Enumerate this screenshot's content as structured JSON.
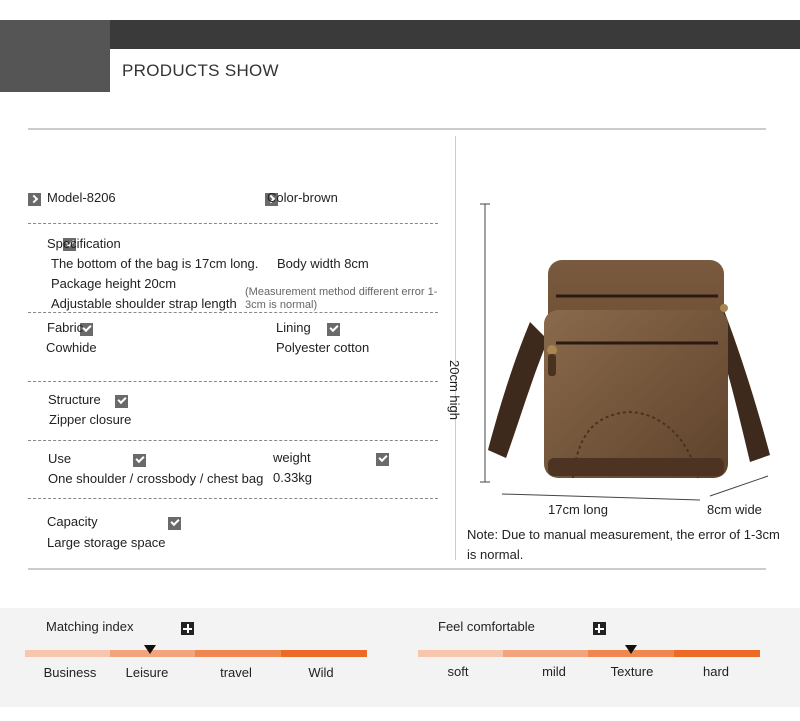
{
  "header": {
    "title": "PRODUCTS SHOW"
  },
  "specs": {
    "model": "Model-8206",
    "color": "Color-brown",
    "specification_title": "Specification",
    "spec_line1": "The bottom of the bag is 17cm long.",
    "spec_line1b": "Body width 8cm",
    "spec_line2": "Package height 20cm",
    "spec_line3": "Adjustable shoulder strap length",
    "spec_note": "(Measurement method different error 1-3cm is normal)",
    "fabric_title": "Fabric",
    "fabric_value": "Cowhide",
    "lining_title": "Lining",
    "lining_value": "Polyester cotton",
    "structure_title": "Structure",
    "structure_value": "Zipper closure",
    "use_title": "Use",
    "use_value": "One shoulder / crossbody / chest bag",
    "weight_title": "weight",
    "weight_value": "0.33kg",
    "capacity_title": "Capacity",
    "capacity_value": "Large storage space"
  },
  "product": {
    "height_label": "20cm high",
    "length_label": "17cm long",
    "width_label": "8cm wide",
    "note": "Note: Due to manual measurement, the error of 1-3cm is normal."
  },
  "matching": {
    "title": "Matching index",
    "labels": [
      "Business",
      "Leisure",
      "travel",
      "Wild"
    ],
    "selected_index": 1
  },
  "comfort": {
    "title": "Feel comfortable",
    "labels": [
      "soft",
      "mild",
      "Texture",
      "hard"
    ],
    "selected_index": 2
  },
  "colors": {
    "scale": [
      "#f7c7ad",
      "#f4a47c",
      "#f0874e",
      "#ec6a25"
    ],
    "accent": "#6b4a2e"
  }
}
